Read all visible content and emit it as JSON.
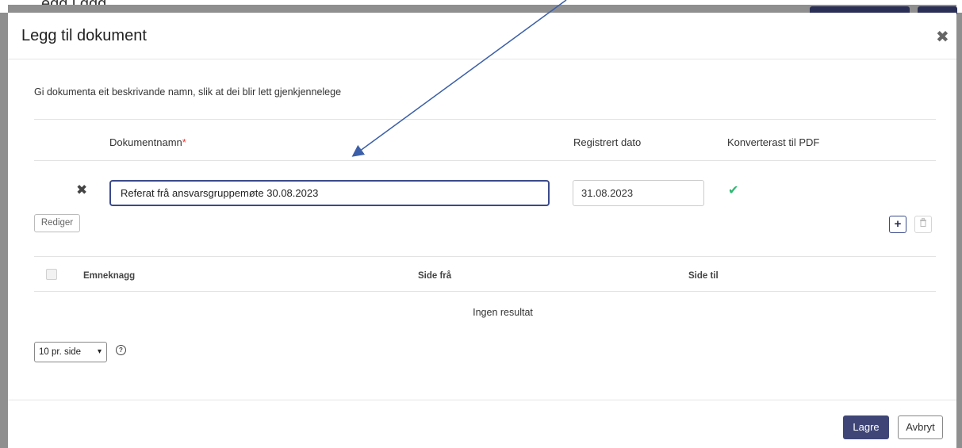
{
  "background": {
    "fragment_text": "egg l ggg"
  },
  "modal": {
    "title": "Legg til dokument",
    "intro": "Gi dokumenta eit beskrivande namn, slik at dei blir lett gjenkjennelege",
    "columns": {
      "name": "Dokumentnamn",
      "required_mark": "*",
      "date": "Registrert dato",
      "pdf": "Konverterast til PDF"
    },
    "row": {
      "name_value": "Referat frå ansvarsgruppemøte 30.08.2023",
      "date_value": "31.08.2023",
      "edit_label": "Rediger"
    },
    "tag_table": {
      "headers": [
        "Emneknagg",
        "Side frå",
        "Side til"
      ],
      "empty_text": "Ingen resultat"
    },
    "pager": {
      "selected": "10 pr. side"
    },
    "footer": {
      "save_label": "Lagre",
      "cancel_label": "Avbryt"
    }
  },
  "colors": {
    "primary": "#3f4677",
    "success": "#2fb872",
    "required": "#e53935",
    "arrow": "#3b5fa8"
  },
  "icons": {
    "close": "close-icon",
    "remove_row": "remove-row-icon",
    "converted": "check-icon",
    "add": "plus-icon",
    "delete": "trash-icon",
    "help": "help-icon"
  }
}
